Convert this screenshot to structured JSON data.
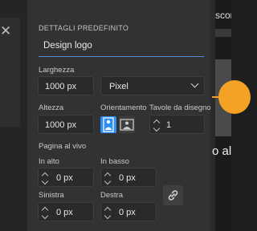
{
  "left_panel": {
    "close_icon": "✕"
  },
  "preset_details": {
    "section_title": "DETTAGLI PREDEFINITO",
    "name_value": "Design logo",
    "width": {
      "label": "Larghezza",
      "value": "1000 px"
    },
    "units": {
      "selected": "Pixel"
    },
    "height": {
      "label": "Altezza",
      "value": "1000 px"
    },
    "orientation": {
      "label": "Orientamento",
      "options": [
        "portrait",
        "landscape"
      ],
      "selected": "portrait"
    },
    "artboards": {
      "label": "Tavole da disegno",
      "value": "1"
    },
    "bleed": {
      "label": "Pagina al vivo",
      "top": {
        "label": "In alto",
        "value": "0 px"
      },
      "bottom": {
        "label": "In basso",
        "value": "0 px"
      },
      "left": {
        "label": "Sinistra",
        "value": "0 px"
      },
      "right": {
        "label": "Destra",
        "value": "0 px"
      }
    }
  },
  "right_preview": {
    "text_top": "scon",
    "text_bottom": "o alt",
    "accent_color": "#f3a225"
  },
  "colors": {
    "accent_blue": "#2f8ff0",
    "focus_underline": "#4b8bd6"
  }
}
